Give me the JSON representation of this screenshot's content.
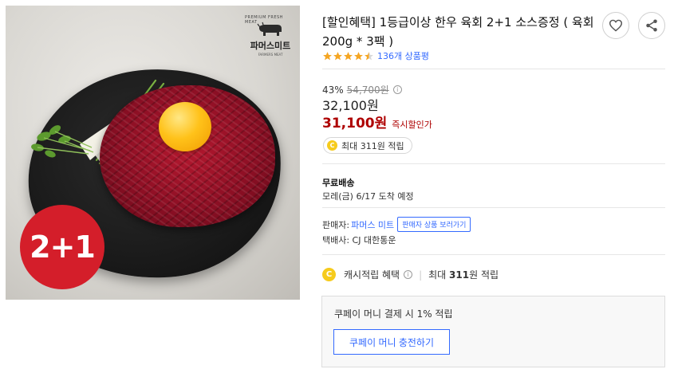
{
  "product": {
    "title": "[할인혜택] 1등급이상 한우 육회 2+1 소스증정 ( 육회 200g * 3팩 )",
    "image_badge": "2+1",
    "brand_logo_text": "파머스미트",
    "brand_logo_arc": "PREMIUM FRESH MEAT",
    "brand_logo_sub": "FARMERS MEAT",
    "rating_stars": 4.5,
    "review_count": "136개 상품평"
  },
  "price": {
    "discount_rate": "43%",
    "original_price": "54,700원",
    "sale_price": "32,100원",
    "coupon_price": "31,100원",
    "coupon_label": "즉시할인가"
  },
  "cash": {
    "pill_text": "최대 311원 적립",
    "coin_symbol": "C",
    "benefit_label": "캐시적립 혜택",
    "benefit_prefix": "최대",
    "benefit_amount": "311",
    "benefit_suffix": "원 적립"
  },
  "delivery": {
    "label": "무료배송",
    "date": "모레(금) 6/17 도착 예정"
  },
  "seller": {
    "label": "판매자:",
    "name": "파머스 미트",
    "link_button": "판매자 상품 보러가기",
    "shipper": "택배사: CJ 대한통운"
  },
  "coupay_money": {
    "text": "쿠페이 머니 결제 시 1% 적립",
    "button": "쿠페이 머니 충전하기"
  },
  "colors": {
    "accent_blue": "#346aff",
    "price_red": "#ae0000",
    "star_orange": "#f5a623",
    "badge_red": "#d41e2a",
    "coin_yellow": "#f6cb1c"
  }
}
